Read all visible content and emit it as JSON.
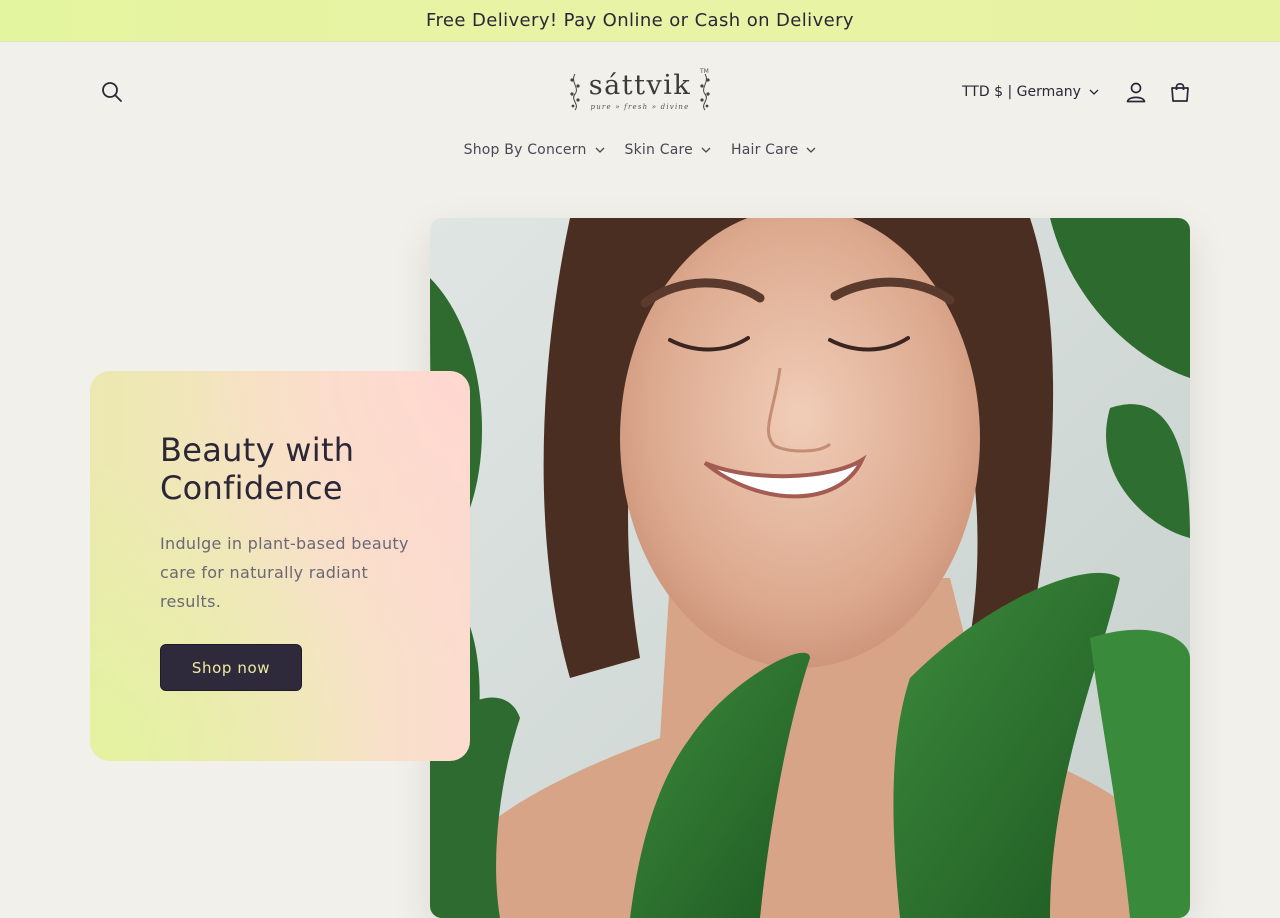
{
  "announcement": {
    "text": "Free Delivery! Pay Online or Cash on Delivery"
  },
  "header": {
    "logo": {
      "word": "sáttvik",
      "tagline": "pure » fresh » divine",
      "tm": "TM"
    },
    "locale_label": "TTD $ | Germany",
    "icons": {
      "search": "search-icon",
      "account": "user-icon",
      "cart": "bag-icon"
    }
  },
  "nav": {
    "items": [
      {
        "label": "Shop By Concern"
      },
      {
        "label": "Skin Care"
      },
      {
        "label": "Hair Care"
      }
    ]
  },
  "hero": {
    "title": "Beauty with Confidence",
    "description": "Indulge in plant-based beauty care for naturally radiant results.",
    "cta_label": "Shop now"
  },
  "colors": {
    "announcement_bg": "#e6f4a2",
    "page_bg": "#f1f0ea",
    "button_bg": "#2f2a3b",
    "button_text": "#f0e9a0",
    "text_dark": "#2b2737"
  }
}
